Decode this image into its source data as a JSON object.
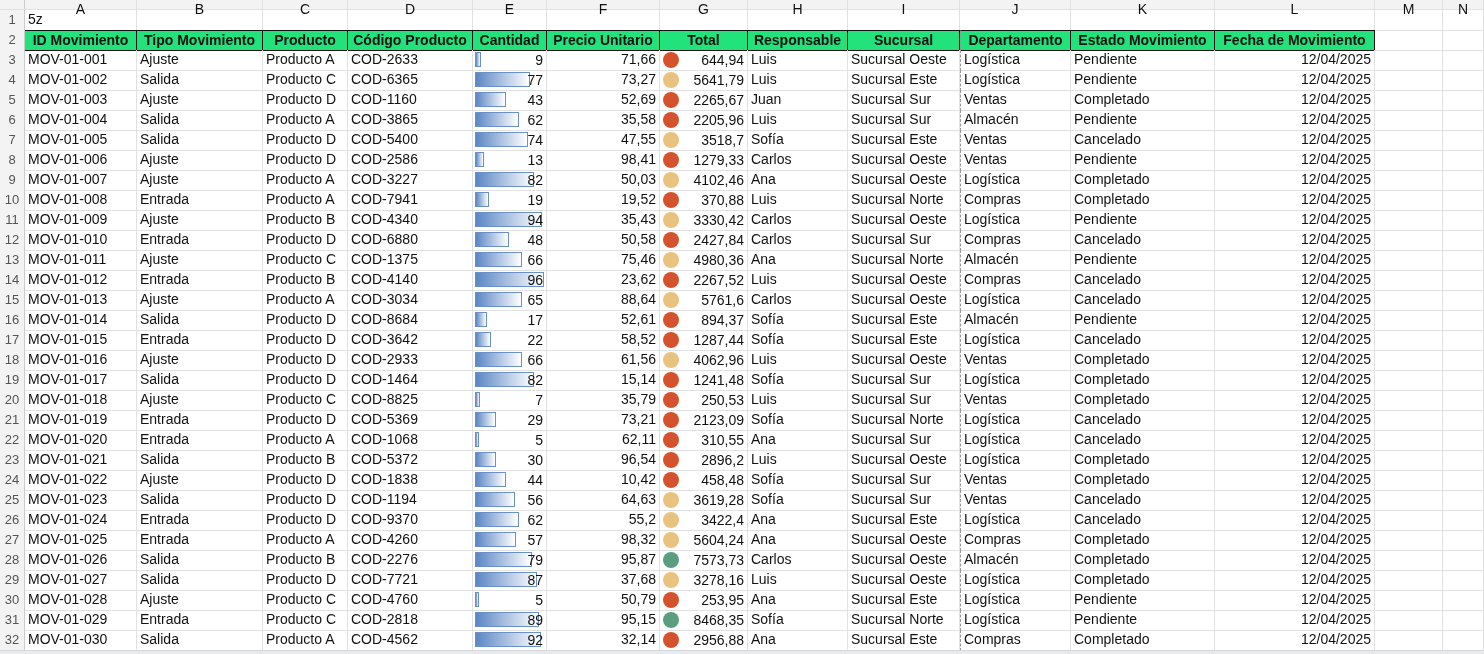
{
  "column_letters": [
    "A",
    "B",
    "C",
    "D",
    "E",
    "F",
    "G",
    "H",
    "I",
    "J",
    "K",
    "L",
    "M",
    "N"
  ],
  "title_row": {
    "row_number": "1",
    "cell": "5z"
  },
  "header_row": {
    "row_number": "2",
    "columns": [
      "ID Movimiento",
      "Tipo Movimiento",
      "Producto",
      "Código Producto",
      "Cantidad",
      "Precio Unitario",
      "Total",
      "Responsable",
      "Sucursal",
      "Departamento",
      "Estado Movimiento",
      "Fecha de Movimiento"
    ]
  },
  "rows": [
    {
      "row_number": "3",
      "id": "MOV-01-001",
      "tipo": "Ajuste",
      "producto": "Producto A",
      "codigo": "COD-2633",
      "cantidad": "9",
      "level": 0.09,
      "precio": "71,66",
      "color": "#d4532e",
      "total": "644,94",
      "responsable": "Luis",
      "sucursal": "Sucursal Oeste",
      "departamento": "Logística",
      "estado": "Pendiente",
      "fecha": "12/04/2025"
    },
    {
      "row_number": "4",
      "id": "MOV-01-002",
      "tipo": "Salida",
      "producto": "Producto C",
      "codigo": "COD-6365",
      "cantidad": "77",
      "level": 0.77,
      "precio": "73,27",
      "color": "#e8c27e",
      "total": "5641,79",
      "responsable": "Luis",
      "sucursal": "Sucursal Este",
      "departamento": "Logística",
      "estado": "Pendiente",
      "fecha": "12/04/2025"
    },
    {
      "row_number": "5",
      "id": "MOV-01-003",
      "tipo": "Ajuste",
      "producto": "Producto D",
      "codigo": "COD-1160",
      "cantidad": "43",
      "level": 0.43,
      "precio": "52,69",
      "color": "#d4532e",
      "total": "2265,67",
      "responsable": "Juan",
      "sucursal": "Sucursal Sur",
      "departamento": "Ventas",
      "estado": "Completado",
      "fecha": "12/04/2025"
    },
    {
      "row_number": "6",
      "id": "MOV-01-004",
      "tipo": "Salida",
      "producto": "Producto A",
      "codigo": "COD-3865",
      "cantidad": "62",
      "level": 0.62,
      "precio": "35,58",
      "color": "#d4532e",
      "total": "2205,96",
      "responsable": "Luis",
      "sucursal": "Sucursal Sur",
      "departamento": "Almacén",
      "estado": "Pendiente",
      "fecha": "12/04/2025"
    },
    {
      "row_number": "7",
      "id": "MOV-01-005",
      "tipo": "Salida",
      "producto": "Producto D",
      "codigo": "COD-5400",
      "cantidad": "74",
      "level": 0.74,
      "precio": "47,55",
      "color": "#e8c27e",
      "total": "3518,7",
      "responsable": "Sofía",
      "sucursal": "Sucursal Este",
      "departamento": "Ventas",
      "estado": "Cancelado",
      "fecha": "12/04/2025"
    },
    {
      "row_number": "8",
      "id": "MOV-01-006",
      "tipo": "Ajuste",
      "producto": "Producto D",
      "codigo": "COD-2586",
      "cantidad": "13",
      "level": 0.13,
      "precio": "98,41",
      "color": "#d4532e",
      "total": "1279,33",
      "responsable": "Carlos",
      "sucursal": "Sucursal Oeste",
      "departamento": "Ventas",
      "estado": "Pendiente",
      "fecha": "12/04/2025"
    },
    {
      "row_number": "9",
      "id": "MOV-01-007",
      "tipo": "Ajuste",
      "producto": "Producto A",
      "codigo": "COD-3227",
      "cantidad": "82",
      "level": 0.82,
      "precio": "50,03",
      "color": "#e8c27e",
      "total": "4102,46",
      "responsable": "Ana",
      "sucursal": "Sucursal Oeste",
      "departamento": "Logística",
      "estado": "Completado",
      "fecha": "12/04/2025"
    },
    {
      "row_number": "10",
      "id": "MOV-01-008",
      "tipo": "Entrada",
      "producto": "Producto A",
      "codigo": "COD-7941",
      "cantidad": "19",
      "level": 0.19,
      "precio": "19,52",
      "color": "#d4532e",
      "total": "370,88",
      "responsable": "Luis",
      "sucursal": "Sucursal Norte",
      "departamento": "Compras",
      "estado": "Completado",
      "fecha": "12/04/2025"
    },
    {
      "row_number": "11",
      "id": "MOV-01-009",
      "tipo": "Ajuste",
      "producto": "Producto B",
      "codigo": "COD-4340",
      "cantidad": "94",
      "level": 0.94,
      "precio": "35,43",
      "color": "#e8c27e",
      "total": "3330,42",
      "responsable": "Carlos",
      "sucursal": "Sucursal Oeste",
      "departamento": "Logística",
      "estado": "Pendiente",
      "fecha": "12/04/2025"
    },
    {
      "row_number": "12",
      "id": "MOV-01-010",
      "tipo": "Entrada",
      "producto": "Producto D",
      "codigo": "COD-6880",
      "cantidad": "48",
      "level": 0.48,
      "precio": "50,58",
      "color": "#d4532e",
      "total": "2427,84",
      "responsable": "Carlos",
      "sucursal": "Sucursal Sur",
      "departamento": "Compras",
      "estado": "Cancelado",
      "fecha": "12/04/2025"
    },
    {
      "row_number": "13",
      "id": "MOV-01-011",
      "tipo": "Ajuste",
      "producto": "Producto C",
      "codigo": "COD-1375",
      "cantidad": "66",
      "level": 0.66,
      "precio": "75,46",
      "color": "#e8c27e",
      "total": "4980,36",
      "responsable": "Ana",
      "sucursal": "Sucursal Norte",
      "departamento": "Almacén",
      "estado": "Pendiente",
      "fecha": "12/04/2025"
    },
    {
      "row_number": "14",
      "id": "MOV-01-012",
      "tipo": "Entrada",
      "producto": "Producto B",
      "codigo": "COD-4140",
      "cantidad": "96",
      "level": 0.96,
      "precio": "23,62",
      "color": "#d4532e",
      "total": "2267,52",
      "responsable": "Luis",
      "sucursal": "Sucursal Oeste",
      "departamento": "Compras",
      "estado": "Cancelado",
      "fecha": "12/04/2025"
    },
    {
      "row_number": "15",
      "id": "MOV-01-013",
      "tipo": "Ajuste",
      "producto": "Producto A",
      "codigo": "COD-3034",
      "cantidad": "65",
      "level": 0.65,
      "precio": "88,64",
      "color": "#e8c27e",
      "total": "5761,6",
      "responsable": "Carlos",
      "sucursal": "Sucursal Oeste",
      "departamento": "Logística",
      "estado": "Cancelado",
      "fecha": "12/04/2025"
    },
    {
      "row_number": "16",
      "id": "MOV-01-014",
      "tipo": "Salida",
      "producto": "Producto D",
      "codigo": "COD-8684",
      "cantidad": "17",
      "level": 0.17,
      "precio": "52,61",
      "color": "#d4532e",
      "total": "894,37",
      "responsable": "Sofía",
      "sucursal": "Sucursal Este",
      "departamento": "Almacén",
      "estado": "Pendiente",
      "fecha": "12/04/2025"
    },
    {
      "row_number": "17",
      "id": "MOV-01-015",
      "tipo": "Entrada",
      "producto": "Producto D",
      "codigo": "COD-3642",
      "cantidad": "22",
      "level": 0.22,
      "precio": "58,52",
      "color": "#d4532e",
      "total": "1287,44",
      "responsable": "Sofía",
      "sucursal": "Sucursal Este",
      "departamento": "Logística",
      "estado": "Cancelado",
      "fecha": "12/04/2025"
    },
    {
      "row_number": "18",
      "id": "MOV-01-016",
      "tipo": "Ajuste",
      "producto": "Producto D",
      "codigo": "COD-2933",
      "cantidad": "66",
      "level": 0.66,
      "precio": "61,56",
      "color": "#e8c27e",
      "total": "4062,96",
      "responsable": "Luis",
      "sucursal": "Sucursal Oeste",
      "departamento": "Ventas",
      "estado": "Completado",
      "fecha": "12/04/2025"
    },
    {
      "row_number": "19",
      "id": "MOV-01-017",
      "tipo": "Salida",
      "producto": "Producto D",
      "codigo": "COD-1464",
      "cantidad": "82",
      "level": 0.82,
      "precio": "15,14",
      "color": "#d4532e",
      "total": "1241,48",
      "responsable": "Sofía",
      "sucursal": "Sucursal Sur",
      "departamento": "Logística",
      "estado": "Completado",
      "fecha": "12/04/2025"
    },
    {
      "row_number": "20",
      "id": "MOV-01-018",
      "tipo": "Ajuste",
      "producto": "Producto C",
      "codigo": "COD-8825",
      "cantidad": "7",
      "level": 0.07,
      "precio": "35,79",
      "color": "#d4532e",
      "total": "250,53",
      "responsable": "Luis",
      "sucursal": "Sucursal Sur",
      "departamento": "Ventas",
      "estado": "Completado",
      "fecha": "12/04/2025"
    },
    {
      "row_number": "21",
      "id": "MOV-01-019",
      "tipo": "Entrada",
      "producto": "Producto D",
      "codigo": "COD-5369",
      "cantidad": "29",
      "level": 0.29,
      "precio": "73,21",
      "color": "#d4532e",
      "total": "2123,09",
      "responsable": "Sofía",
      "sucursal": "Sucursal Norte",
      "departamento": "Logística",
      "estado": "Cancelado",
      "fecha": "12/04/2025"
    },
    {
      "row_number": "22",
      "id": "MOV-01-020",
      "tipo": "Entrada",
      "producto": "Producto A",
      "codigo": "COD-1068",
      "cantidad": "5",
      "level": 0.05,
      "precio": "62,11",
      "color": "#d4532e",
      "total": "310,55",
      "responsable": "Ana",
      "sucursal": "Sucursal Sur",
      "departamento": "Logística",
      "estado": "Cancelado",
      "fecha": "12/04/2025"
    },
    {
      "row_number": "23",
      "id": "MOV-01-021",
      "tipo": "Salida",
      "producto": "Producto B",
      "codigo": "COD-5372",
      "cantidad": "30",
      "level": 0.3,
      "precio": "96,54",
      "color": "#d4532e",
      "total": "2896,2",
      "responsable": "Luis",
      "sucursal": "Sucursal Oeste",
      "departamento": "Logística",
      "estado": "Completado",
      "fecha": "12/04/2025"
    },
    {
      "row_number": "24",
      "id": "MOV-01-022",
      "tipo": "Ajuste",
      "producto": "Producto D",
      "codigo": "COD-1838",
      "cantidad": "44",
      "level": 0.44,
      "precio": "10,42",
      "color": "#d4532e",
      "total": "458,48",
      "responsable": "Sofía",
      "sucursal": "Sucursal Sur",
      "departamento": "Ventas",
      "estado": "Completado",
      "fecha": "12/04/2025"
    },
    {
      "row_number": "25",
      "id": "MOV-01-023",
      "tipo": "Salida",
      "producto": "Producto D",
      "codigo": "COD-1194",
      "cantidad": "56",
      "level": 0.56,
      "precio": "64,63",
      "color": "#e8c27e",
      "total": "3619,28",
      "responsable": "Sofía",
      "sucursal": "Sucursal Sur",
      "departamento": "Ventas",
      "estado": "Cancelado",
      "fecha": "12/04/2025"
    },
    {
      "row_number": "26",
      "id": "MOV-01-024",
      "tipo": "Entrada",
      "producto": "Producto D",
      "codigo": "COD-9370",
      "cantidad": "62",
      "level": 0.62,
      "precio": "55,2",
      "color": "#e8c27e",
      "total": "3422,4",
      "responsable": "Ana",
      "sucursal": "Sucursal Este",
      "departamento": "Logística",
      "estado": "Cancelado",
      "fecha": "12/04/2025"
    },
    {
      "row_number": "27",
      "id": "MOV-01-025",
      "tipo": "Entrada",
      "producto": "Producto A",
      "codigo": "COD-4260",
      "cantidad": "57",
      "level": 0.57,
      "precio": "98,32",
      "color": "#e8c27e",
      "total": "5604,24",
      "responsable": "Ana",
      "sucursal": "Sucursal Oeste",
      "departamento": "Compras",
      "estado": "Completado",
      "fecha": "12/04/2025"
    },
    {
      "row_number": "28",
      "id": "MOV-01-026",
      "tipo": "Salida",
      "producto": "Producto B",
      "codigo": "COD-2276",
      "cantidad": "79",
      "level": 0.79,
      "precio": "95,87",
      "color": "#5a9e7f",
      "total": "7573,73",
      "responsable": "Carlos",
      "sucursal": "Sucursal Oeste",
      "departamento": "Almacén",
      "estado": "Completado",
      "fecha": "12/04/2025"
    },
    {
      "row_number": "29",
      "id": "MOV-01-027",
      "tipo": "Salida",
      "producto": "Producto D",
      "codigo": "COD-7721",
      "cantidad": "87",
      "level": 0.87,
      "precio": "37,68",
      "color": "#e8c27e",
      "total": "3278,16",
      "responsable": "Luis",
      "sucursal": "Sucursal Oeste",
      "departamento": "Logística",
      "estado": "Completado",
      "fecha": "12/04/2025"
    },
    {
      "row_number": "30",
      "id": "MOV-01-028",
      "tipo": "Ajuste",
      "producto": "Producto C",
      "codigo": "COD-4760",
      "cantidad": "5",
      "level": 0.05,
      "precio": "50,79",
      "color": "#d4532e",
      "total": "253,95",
      "responsable": "Ana",
      "sucursal": "Sucursal Este",
      "departamento": "Logística",
      "estado": "Pendiente",
      "fecha": "12/04/2025"
    },
    {
      "row_number": "31",
      "id": "MOV-01-029",
      "tipo": "Entrada",
      "producto": "Producto C",
      "codigo": "COD-2818",
      "cantidad": "89",
      "level": 0.89,
      "precio": "95,15",
      "color": "#5a9e7f",
      "total": "8468,35",
      "responsable": "Sofía",
      "sucursal": "Sucursal Norte",
      "departamento": "Logística",
      "estado": "Pendiente",
      "fecha": "12/04/2025"
    },
    {
      "row_number": "32",
      "id": "MOV-01-030",
      "tipo": "Salida",
      "producto": "Producto A",
      "codigo": "COD-4562",
      "cantidad": "92",
      "level": 0.92,
      "precio": "32,14",
      "color": "#d4532e",
      "total": "2956,88",
      "responsable": "Ana",
      "sucursal": "Sucursal Este",
      "departamento": "Compras",
      "estado": "Completado",
      "fecha": "12/04/2025"
    }
  ]
}
